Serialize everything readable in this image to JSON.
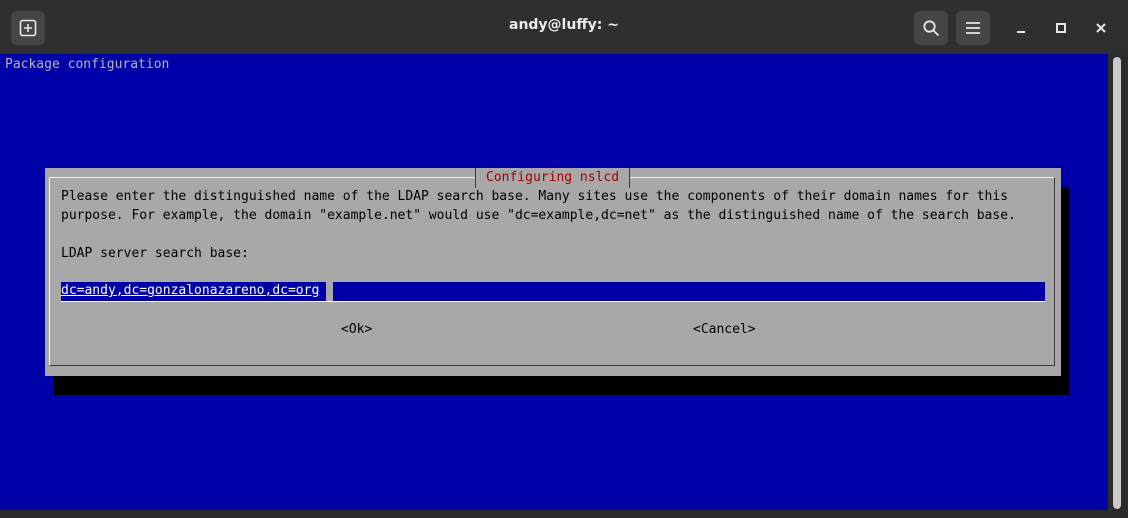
{
  "window": {
    "title": "andy@luffy: ~",
    "icons": {
      "new_tab": "new-tab-icon",
      "search": "search-icon",
      "menu": "hamburger-menu-icon",
      "minimize": "minimize-icon",
      "maximize": "maximize-icon",
      "close": "close-icon"
    }
  },
  "terminal": {
    "header": "Package configuration",
    "colors": {
      "background": "#0000a8",
      "dialog": "#a8a8a8",
      "title": "#a80000"
    }
  },
  "dialog": {
    "title": "Configuring nslcd",
    "line1": "Please enter the distinguished name of the LDAP search base. Many sites use the components of their domain names for this",
    "line2": "purpose. For example, the domain \"example.net\" would use \"dc=example,dc=net\" as the distinguished name of the search base.",
    "prompt": "LDAP server search base:",
    "input_value": "dc=andy,dc=gonzalonazareno,dc=org",
    "ok_label": "<Ok>",
    "cancel_label": "<Cancel>"
  }
}
